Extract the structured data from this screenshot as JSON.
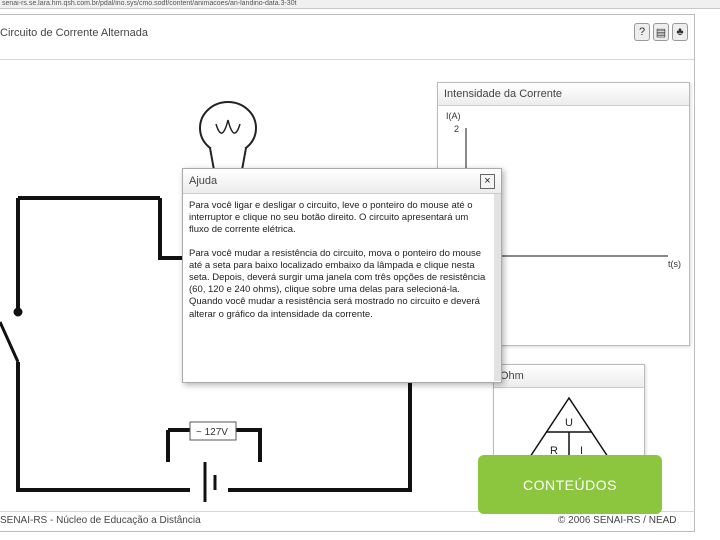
{
  "browser": {
    "url": "senai-rs.se.lara.hm.qsh.com.br/pdal/ino.sys/cmo.sodf/content/animacoes/an-landino-data.3-30t"
  },
  "app": {
    "title": "Circuito de Corrente Alternada",
    "icons": [
      "help-icon",
      "book-icon",
      "tree-icon"
    ]
  },
  "chart": {
    "title": "Intensidade da Corrente",
    "y_axis_label": "I(A)",
    "y_tick": "2",
    "x_axis_label": "t(s)",
    "chart_data": {
      "type": "line",
      "title": "Intensidade da Corrente",
      "xlabel": "t(s)",
      "ylabel": "I(A)",
      "series": []
    }
  },
  "dialog": {
    "title": "Ajuda",
    "close_label": "×",
    "paragraph1": "Para você ligar e desligar o circuito, leve o ponteiro do mouse até o interruptor e clique no seu botão direito. O circuito apresentará um fluxo de corrente elétrica.",
    "paragraph2": "Para você mudar a resistência do circuito, mova o ponteiro do mouse até a seta para baixo localizado embaixo da lâmpada e clique nesta seta. Depois, deverá surgir uma janela com três opções de resistência (60, 120 e 240 ohms), clique sobre uma delas para selecioná-la. Quando você mudar a resistência será mostrado no circuito e deverá alterar o gráfico da intensidade da corrente."
  },
  "source": {
    "label": "~ 127V"
  },
  "formula_panel": {
    "title": "Ohm",
    "top": "U",
    "bottom_left": "R",
    "bottom_right": "I"
  },
  "cta": {
    "label": "CONTEÚDOS"
  },
  "footer": {
    "left": "SENAI-RS - Núcleo de Educação a Distância",
    "right": "© 2006 SENAI-RS / NEAD"
  }
}
